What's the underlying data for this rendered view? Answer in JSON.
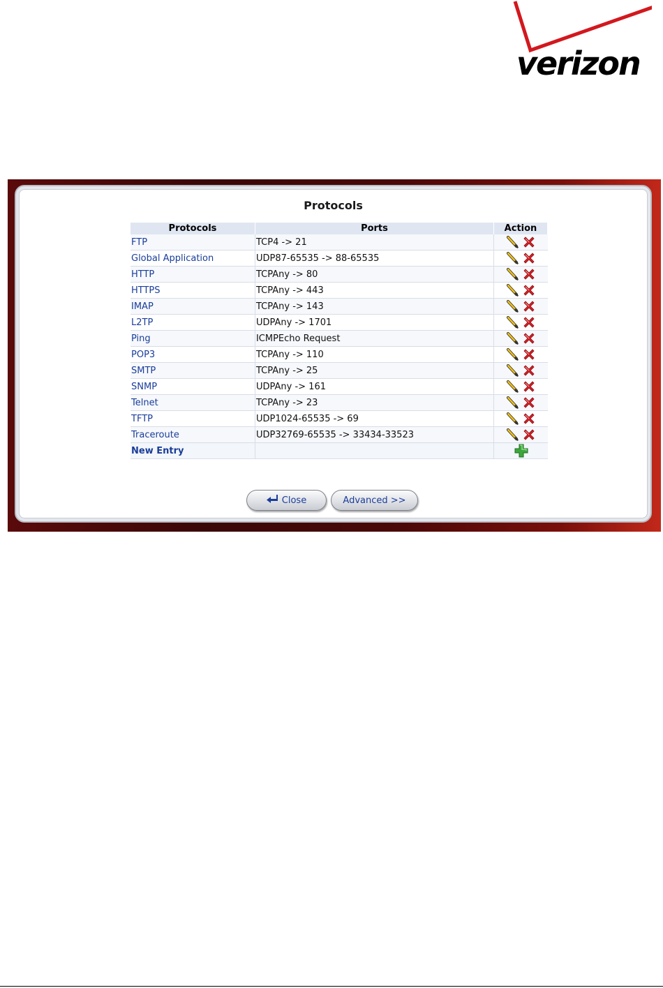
{
  "logo": {
    "text": "verizon",
    "check_color": "#d2181e"
  },
  "panel": {
    "title": "Protocols"
  },
  "table": {
    "headers": [
      "Protocols",
      "Ports",
      "Action"
    ],
    "rows": [
      {
        "protocol": "FTP",
        "ports": "TCP4 -> 21"
      },
      {
        "protocol": "Global Application",
        "ports": "UDP87-65535 -> 88-65535"
      },
      {
        "protocol": "HTTP",
        "ports": "TCPAny -> 80"
      },
      {
        "protocol": "HTTPS",
        "ports": "TCPAny -> 443"
      },
      {
        "protocol": "IMAP",
        "ports": "TCPAny -> 143"
      },
      {
        "protocol": "L2TP",
        "ports": "UDPAny -> 1701"
      },
      {
        "protocol": "Ping",
        "ports": "ICMPEcho Request"
      },
      {
        "protocol": "POP3",
        "ports": "TCPAny -> 110"
      },
      {
        "protocol": "SMTP",
        "ports": "TCPAny -> 25"
      },
      {
        "protocol": "SNMP",
        "ports": "UDPAny -> 161"
      },
      {
        "protocol": "Telnet",
        "ports": "TCPAny -> 23"
      },
      {
        "protocol": "TFTP",
        "ports": "UDP1024-65535 -> 69"
      },
      {
        "protocol": "Traceroute",
        "ports": "UDP32769-65535 -> 33434-33523"
      }
    ],
    "new_entry_label": "New Entry",
    "row_icons": [
      "edit-pencil-icon",
      "delete-x-icon"
    ],
    "new_entry_icon": "add-plus-icon"
  },
  "buttons": {
    "close_label": "Close",
    "advanced_label": "Advanced >>"
  },
  "colors": {
    "link": "#1a3d9a",
    "header_bg": "#dfe6f2",
    "frame_red": "#c2281a",
    "delete_red": "#d8202a",
    "add_green": "#3ca83c"
  }
}
